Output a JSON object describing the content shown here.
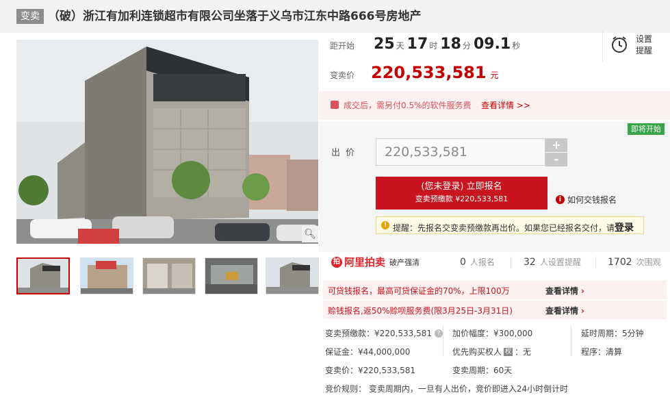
{
  "header": {
    "tag": "变卖",
    "title": "（破）浙江有加利连锁超市有限公司坐落于义乌市江东中路666号房地产"
  },
  "countdown": {
    "label": "距开始",
    "days": "25",
    "days_unit": "天",
    "hours": "17",
    "hours_unit": "时",
    "minutes": "18",
    "minutes_unit": "分",
    "seconds": "09.1",
    "seconds_unit": "秒"
  },
  "remind": {
    "line1": "设置",
    "line2": "提醒",
    "icon": "alarm-clock-icon"
  },
  "price": {
    "label": "变卖价",
    "value": "220,533,581",
    "unit": "元"
  },
  "fee_notice": {
    "text": "成交后，需另付0.5%的软件服务费",
    "link": "查看详情 >>"
  },
  "bid": {
    "status_badge": "即将开始",
    "label": "出价",
    "input_value": "220,533,581",
    "plus": "+",
    "minus": "-",
    "signup_line1": "(您未登录) 立即报名",
    "signup_line2": "变卖预缴款 ¥220,533,581",
    "howto": "如何交钱报名",
    "tip_prefix": "提醒：先报名交变卖预缴款再出价。如果您已经报名交付，请",
    "tip_login": "登录"
  },
  "brand": {
    "name": "阿里拍卖",
    "sub": "破产强清"
  },
  "stats": {
    "enrolled_num": "0",
    "enrolled_unit": "人报名",
    "reminders_num": "32",
    "reminders_unit": "人设置提醒",
    "views_num": "1702",
    "views_unit": "次围观"
  },
  "promos": [
    {
      "text": "可贷钱报名，最高可贷保证金的70%，上限100万",
      "link": "查看详情"
    },
    {
      "text": "赊钱报名,返50%赊呗服务费(限3月25日-3月31日)",
      "link": "查看详情"
    }
  ],
  "info": {
    "deposit_pre": "变卖预缴款：¥220,533,581",
    "increment": "加价幅度：¥300,000",
    "delay": "延时周期：5分钟",
    "guarantee": "保证金：¥44,000,000",
    "priority_label": "优先购买权人",
    "priority_tag": "权",
    "priority_value": "：无",
    "procedure": "程序：清算",
    "sale_price": "变卖价：¥220,533,581",
    "period": "变卖周期：60天",
    "rule": "竞价规则：  变卖周期内，一旦有人出价，竞价即进入24小时倒计时"
  },
  "colors": {
    "accent": "#c40000",
    "button": "#c8141e",
    "badge_green": "#39a44a"
  }
}
